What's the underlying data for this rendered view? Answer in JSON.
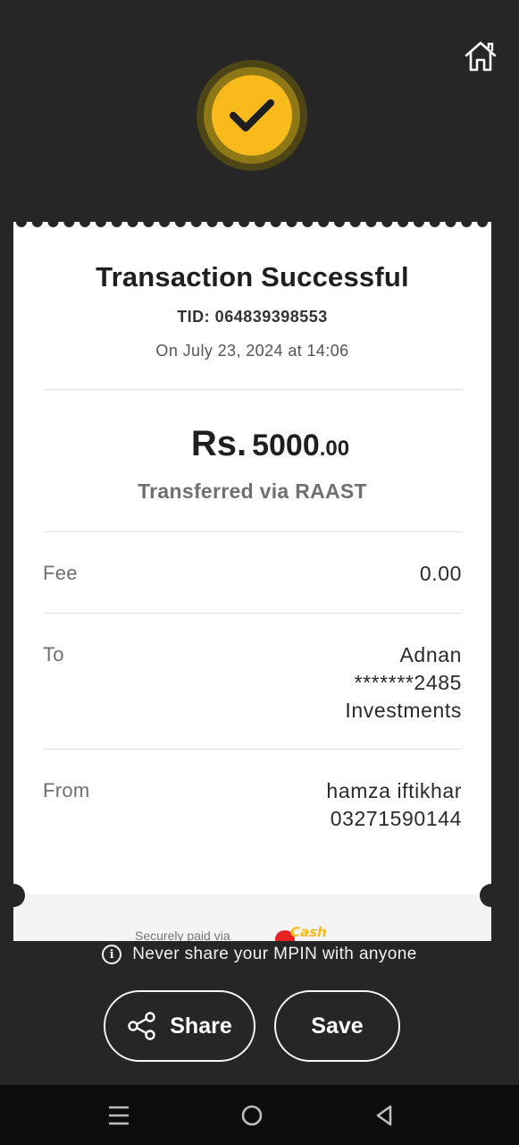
{
  "receipt": {
    "title": "Transaction Successful",
    "tid": "TID: 064839398553",
    "date": "On July 23, 2024 at 14:06",
    "amount_currency": "Rs.",
    "amount_whole": "5000",
    "amount_decimal": ".00",
    "method": "Transferred via RAAST",
    "fee_label": "Fee",
    "fee_value": "0.00",
    "to_label": "To",
    "to_lines": [
      "Adnan",
      "*******2485",
      "Investments"
    ],
    "from_label": "From",
    "from_lines": [
      "hamza iftikhar",
      "03271590144"
    ],
    "secure_text": "Securely paid via",
    "logo_text": "JazzCash"
  },
  "warning": {
    "text": "Never share your MPIN with anyone"
  },
  "actions": {
    "share_label": "Share",
    "save_label": "Save"
  },
  "icons": [
    "home-icon",
    "success-check-icon",
    "info-icon",
    "share-icon",
    "menu-icon",
    "home-circle-icon",
    "back-icon"
  ],
  "colors": {
    "accent": "#f9bb1c",
    "background": "#262626",
    "card": "#ffffff"
  }
}
